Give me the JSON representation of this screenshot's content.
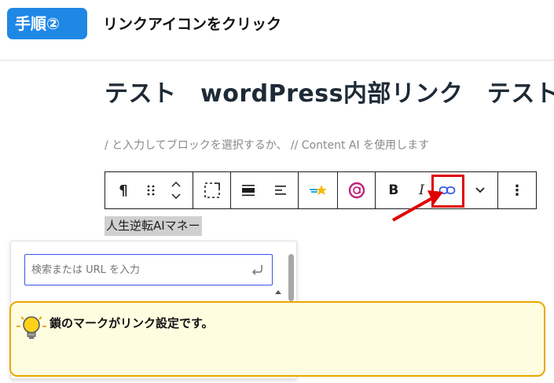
{
  "header": {
    "step_label": "手順②",
    "step_title": "リンクアイコンをクリック"
  },
  "editor": {
    "post_title": "テスト　wordPress内部リンク　テスト",
    "block_placeholder": "/ と入力してブロックを選択するか、 // Content AI を使用します",
    "selected_text": "人生逆転AIマネー"
  },
  "toolbar": {
    "paragraph_glyph": "¶",
    "bold_label": "B",
    "italic_label": "I",
    "more_glyph": "⋮"
  },
  "link_popover": {
    "search_placeholder": "検索または URL を入力"
  },
  "hint": {
    "text": "鎖のマークがリンク設定です。"
  },
  "colors": {
    "step_badge": "#1f88e5",
    "highlight": "#e00000",
    "hint_border": "#e8a800",
    "hint_bg": "#fffde0",
    "input_focus": "#3858e9"
  }
}
